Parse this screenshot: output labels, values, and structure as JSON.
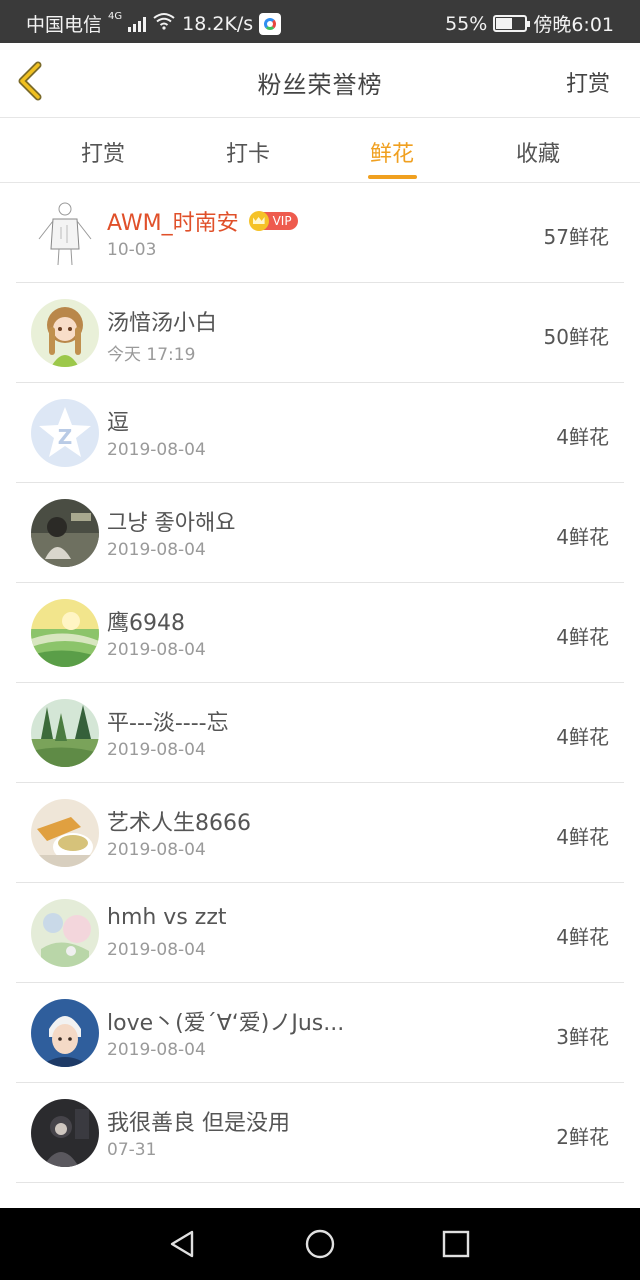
{
  "status_bar": {
    "carrier": "中国电信",
    "network_tag": "4G",
    "speed": "18.2K/s",
    "battery_percent": "55%",
    "time": "傍晚6:01"
  },
  "header": {
    "title": "粉丝荣誉榜",
    "right_action": "打赏"
  },
  "tabs": [
    {
      "label": "打赏",
      "active": false
    },
    {
      "label": "打卡",
      "active": false
    },
    {
      "label": "鲜花",
      "active": true
    },
    {
      "label": "收藏",
      "active": false
    }
  ],
  "vip_label": "VIP",
  "colors": {
    "accent": "#f0a020",
    "vip_name": "#e0502a",
    "status_bar": "#3a3a3a",
    "nav_bar": "#000000"
  },
  "fans": [
    {
      "name": "AWM_时南安",
      "date": "10-03",
      "count": "57鲜花",
      "vip": true,
      "avatar": "sketch-figure"
    },
    {
      "name": "汤愔汤小白",
      "date": "今天 17:19",
      "count": "50鲜花",
      "vip": false,
      "avatar": "anime-girl"
    },
    {
      "name": "逗",
      "date": "2019-08-04",
      "count": "4鲜花",
      "vip": false,
      "avatar": "qq-default"
    },
    {
      "name": "그냥 좋아해요",
      "date": "2019-08-04",
      "count": "4鲜花",
      "vip": false,
      "avatar": "dark-photo"
    },
    {
      "name": "鹰6948",
      "date": "2019-08-04",
      "count": "4鲜花",
      "vip": false,
      "avatar": "sunset-landscape"
    },
    {
      "name": "平---淡----忘",
      "date": "2019-08-04",
      "count": "4鲜花",
      "vip": false,
      "avatar": "forest"
    },
    {
      "name": "艺术人生8666",
      "date": "2019-08-04",
      "count": "4鲜花",
      "vip": false,
      "avatar": "tea-cup"
    },
    {
      "name": "hmh vs zzt",
      "date": "2019-08-04",
      "count": "4鲜花",
      "vip": false,
      "avatar": "pastel-art"
    },
    {
      "name": "love丶(爱´∀‘爱)ノJus...",
      "date": "2019-08-04",
      "count": "3鲜花",
      "vip": false,
      "avatar": "boy-portrait"
    },
    {
      "name": "我很善良 但是没用",
      "date": "07-31",
      "count": "2鲜花",
      "vip": false,
      "avatar": "dark-figure"
    }
  ]
}
